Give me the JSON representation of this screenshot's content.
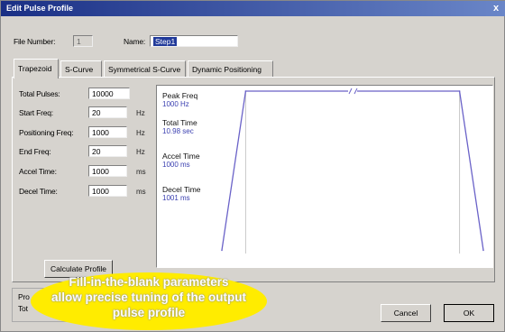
{
  "window": {
    "title": "Edit Pulse Profile",
    "close_glyph": "x"
  },
  "header": {
    "file_number_label": "File Number:",
    "file_number_value": "1",
    "name_label": "Name:",
    "name_value": "Step1"
  },
  "tabs": [
    {
      "label": "Trapezoid",
      "active": true
    },
    {
      "label": "S-Curve",
      "active": false
    },
    {
      "label": "Symmetrical S-Curve",
      "active": false
    },
    {
      "label": "Dynamic Positioning",
      "active": false
    }
  ],
  "params": {
    "total_pulses": {
      "label": "Total Pulses:",
      "value": "10000",
      "unit": ""
    },
    "start_freq": {
      "label": "Start Freq:",
      "value": "20",
      "unit": "Hz"
    },
    "positioning_freq": {
      "label": "Positioning Freq:",
      "value": "1000",
      "unit": "Hz"
    },
    "end_freq": {
      "label": "End Freq:",
      "value": "20",
      "unit": "Hz"
    },
    "accel_time": {
      "label": "Accel Time:",
      "value": "1000",
      "unit": "ms"
    },
    "decel_time": {
      "label": "Decel Time:",
      "value": "1000",
      "unit": "ms"
    }
  },
  "buttons": {
    "calculate": "Calculate Profile",
    "cancel": "Cancel",
    "ok": "OK"
  },
  "groupbox": {
    "line1": "Pro",
    "line2": "Tot"
  },
  "stats": {
    "peak_freq": {
      "label": "Peak Freq",
      "value": "1000 Hz"
    },
    "total_time": {
      "label": "Total Time",
      "value": "10.98 sec"
    },
    "accel_time": {
      "label": "Accel Time",
      "value": "1000 ms"
    },
    "decel_time": {
      "label": "Decel Time",
      "value": "1001 ms"
    }
  },
  "chart_data": {
    "type": "line",
    "title": "",
    "xlabel": "",
    "ylabel": "",
    "series": [
      {
        "x": [
          0,
          1,
          9.98,
          10.98
        ],
        "y": [
          20,
          1000,
          1000,
          20
        ]
      }
    ],
    "axis_break_on_plateau": true,
    "guides_at_x": [
      1,
      9.98
    ],
    "line_color": "#6a62c8"
  },
  "callout": {
    "line1": "Fill-in-the-blank parameters",
    "line2": "allow precise tuning of the output",
    "line3": "pulse profile",
    "color": "#ffec00"
  }
}
